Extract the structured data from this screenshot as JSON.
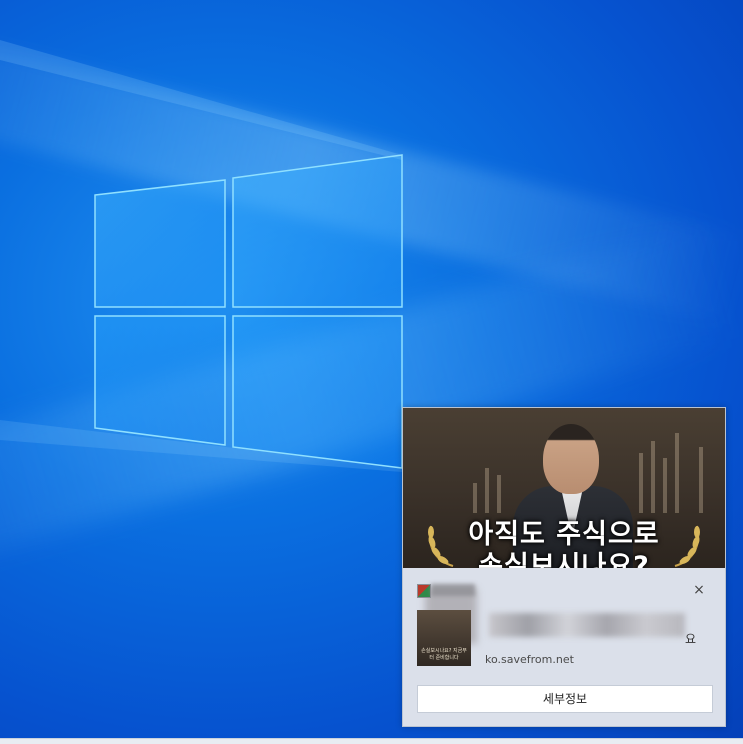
{
  "notification": {
    "headline_line1": "아직도 주식으로",
    "headline_line2": "손실보시나요?",
    "title_suffix": "요",
    "source": "ko.savefrom.net",
    "close_glyph": "×",
    "action_label": "세부정보",
    "thumb_text": "손실보시나요? 지금부터 준비합니다"
  },
  "colors": {
    "desktop_blue": "#0a6fe0",
    "toast_bg": "#dbe0ea"
  }
}
